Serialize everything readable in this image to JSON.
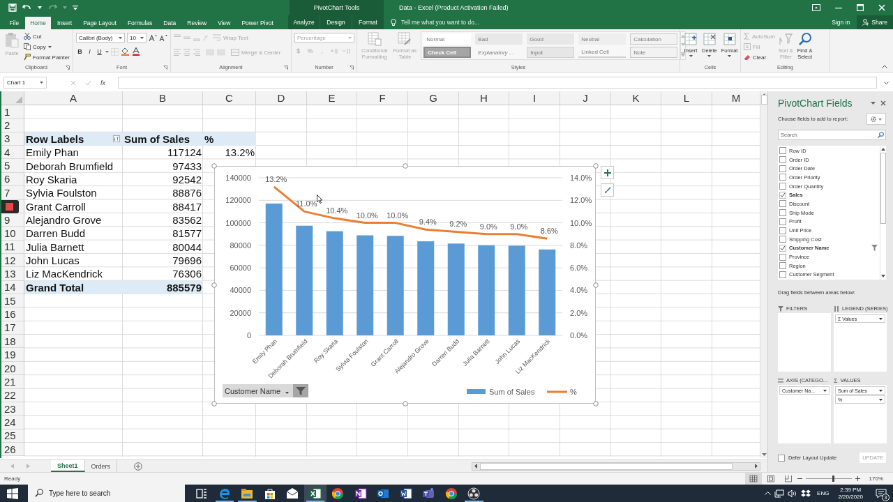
{
  "title_bar": {
    "contextual_label": "PivotChart Tools",
    "title": "Data - Excel (Product Activation Failed)"
  },
  "tabs": [
    {
      "label": "File",
      "selected": false,
      "contextual": false
    },
    {
      "label": "Home",
      "selected": true,
      "contextual": false
    },
    {
      "label": "Insert",
      "selected": false,
      "contextual": false
    },
    {
      "label": "Page Layout",
      "selected": false,
      "contextual": false
    },
    {
      "label": "Formulas",
      "selected": false,
      "contextual": false
    },
    {
      "label": "Data",
      "selected": false,
      "contextual": false
    },
    {
      "label": "Review",
      "selected": false,
      "contextual": false
    },
    {
      "label": "View",
      "selected": false,
      "contextual": false
    },
    {
      "label": "Power Pivot",
      "selected": false,
      "contextual": false
    },
    {
      "label": "Analyze",
      "selected": false,
      "contextual": true
    },
    {
      "label": "Design",
      "selected": false,
      "contextual": true
    },
    {
      "label": "Format",
      "selected": false,
      "contextual": true
    }
  ],
  "tell_me": {
    "placeholder": "Tell me what you want to do..."
  },
  "account": {
    "sign_in": "Sign in",
    "share": "Share"
  },
  "ribbon": {
    "clipboard": {
      "label": "Clipboard",
      "paste": {
        "label": "Paste",
        "disabled": true
      },
      "cut": {
        "label": "Cut",
        "disabled": false
      },
      "copy": {
        "label": "Copy",
        "disabled": false
      },
      "format_painter": {
        "label": "Format Painter",
        "disabled": false
      }
    },
    "font": {
      "label": "Font",
      "font_name": "Calibri (Body)",
      "font_size": "10",
      "bold": "B",
      "italic": "I",
      "underline": "U"
    },
    "alignment": {
      "label": "Alignment",
      "wrap_text": {
        "label": "Wrap Text",
        "disabled": true
      },
      "merge_center": {
        "label": "Merge & Center",
        "disabled": true
      }
    },
    "number": {
      "label": "Number",
      "format": "Percentage",
      "currency": "$",
      "percent": "%",
      "comma": ","
    },
    "styles": {
      "label": "Styles",
      "conditional_formatting": {
        "lines": [
          "Conditional",
          "Formatting"
        ],
        "disabled": true
      },
      "format_as_table": {
        "lines": [
          "Format as",
          "Table"
        ],
        "disabled": true
      },
      "cell_styles": [
        {
          "label": "Normal",
          "kind": "normal"
        },
        {
          "label": "Bad",
          "kind": "bad"
        },
        {
          "label": "Good",
          "kind": "good"
        },
        {
          "label": "Neutral",
          "kind": "neutral"
        },
        {
          "label": "Calculation",
          "kind": "calculation"
        },
        {
          "label": "Check Cell",
          "kind": "check"
        },
        {
          "label": "Explanatory ...",
          "kind": "explanatory"
        },
        {
          "label": "Input",
          "kind": "input"
        },
        {
          "label": "Linked Cell",
          "kind": "linked"
        },
        {
          "label": "Note",
          "kind": "note"
        }
      ]
    },
    "cells": {
      "label": "Cells",
      "buttons": [
        {
          "label": "Insert",
          "disabled": false
        },
        {
          "label": "Delete",
          "disabled": false
        },
        {
          "label": "Format",
          "disabled": false
        }
      ]
    },
    "editing": {
      "label": "Editing",
      "autosum": {
        "label": "AutoSum",
        "disabled": true
      },
      "fill": {
        "label": "Fill",
        "disabled": true
      },
      "clear": {
        "label": "Clear",
        "disabled": false
      },
      "sort_filter": {
        "lines": [
          "Sort &",
          "Filter"
        ],
        "disabled": true
      },
      "find_select": {
        "lines": [
          "Find &",
          "Select"
        ],
        "disabled": false
      }
    }
  },
  "formula_bar": {
    "name_box": "Chart 1",
    "fx": "fx"
  },
  "sheet": {
    "columns": [
      "A",
      "B",
      "C",
      "D",
      "E",
      "F",
      "G",
      "H",
      "I",
      "J",
      "K",
      "L",
      "M"
    ],
    "row_numbers": [
      {
        "label": "1"
      },
      {
        "label": "2"
      },
      {
        "label": "3"
      },
      {
        "label": "4"
      },
      {
        "label": "5"
      },
      {
        "label": "6"
      },
      {
        "label": "7"
      },
      {
        "covered": true
      },
      {
        "label": "9"
      },
      {
        "label": "10"
      },
      {
        "label": "11"
      },
      {
        "label": "12"
      },
      {
        "label": "13"
      },
      {
        "label": "14"
      },
      {
        "label": "15"
      },
      {
        "label": "16"
      },
      {
        "label": "17"
      },
      {
        "label": "18"
      },
      {
        "label": "19"
      },
      {
        "label": "20"
      },
      {
        "label": "21"
      },
      {
        "label": "22"
      },
      {
        "label": "23"
      },
      {
        "label": "24"
      },
      {
        "label": "25"
      },
      {
        "label": "26"
      }
    ],
    "pivot": {
      "header": {
        "row_labels": "Row Labels",
        "sum": "Sum of Sales",
        "pct": "%"
      },
      "rows": [
        {
          "name": "Emily Phan",
          "sales": "117124",
          "pct": "13.2%"
        },
        {
          "name": "Deborah Brumfield",
          "sales": "97433"
        },
        {
          "name": "Roy Skaria",
          "sales": "92542"
        },
        {
          "name": "Sylvia Foulston",
          "sales": "88876"
        },
        {
          "name": "Grant Carroll",
          "sales": "88417"
        },
        {
          "name": "Alejandro Grove",
          "sales": "83562"
        },
        {
          "name": "Darren Budd",
          "sales": "81577"
        },
        {
          "name": "Julia Barnett",
          "sales": "80044"
        },
        {
          "name": "John Lucas",
          "sales": "79696"
        },
        {
          "name": "Liz MacKendrick",
          "sales": "76306"
        }
      ],
      "total": {
        "label": "Grand Total",
        "sales": "885579"
      }
    },
    "tabs": [
      {
        "label": "Sheet1",
        "selected": true
      },
      {
        "label": "Orders",
        "selected": false
      }
    ]
  },
  "chart": {
    "field_button": "Customer Name",
    "chart_data": {
      "type": "bar",
      "categories": [
        "Emily Phan",
        "Deborah Brumfield",
        "Roy Skaria",
        "Sylvia Foulston",
        "Grant Carroll",
        "Alejandro Grove",
        "Darren Budd",
        "Julia Barnett",
        "John Lucas",
        "Liz MacKendrick"
      ],
      "series": [
        {
          "name": "Sum of Sales",
          "type": "bar",
          "color": "#5b9bd5",
          "values": [
            117124,
            97433,
            92542,
            88876,
            88417,
            83562,
            81577,
            80044,
            79696,
            76306
          ]
        },
        {
          "name": "%",
          "type": "line",
          "axis": "y2",
          "color": "#ed7d31",
          "values": [
            13.2,
            11.0,
            10.4,
            10.0,
            10.0,
            9.4,
            9.2,
            9.0,
            9.0,
            8.6
          ],
          "value_labels": [
            "13.2%",
            "11.0%",
            "10.4%",
            "10.0%",
            "10.0%",
            "9.4%",
            "9.2%",
            "9.0%",
            "9.0%",
            "8.6%"
          ]
        }
      ],
      "grid": true,
      "legend": "bottom",
      "ylim": [
        0,
        140000
      ],
      "yticks": [
        0,
        20000,
        40000,
        60000,
        80000,
        100000,
        120000,
        140000
      ],
      "y2lim": [
        0,
        14
      ],
      "y2ticks": [
        {
          "value": 0,
          "label": "0.0%"
        },
        {
          "value": 2,
          "label": "2.0%"
        },
        {
          "value": 4,
          "label": "4.0%"
        },
        {
          "value": 6,
          "label": "6.0%"
        },
        {
          "value": 8,
          "label": "8.0%"
        },
        {
          "value": 10,
          "label": "10.0%"
        },
        {
          "value": 12,
          "label": "12.0%"
        },
        {
          "value": 14,
          "label": "14.0%"
        }
      ]
    }
  },
  "field_pane": {
    "title": "PivotChart Fields",
    "prompt": "Choose fields to add to report:",
    "search": {
      "placeholder": "Search"
    },
    "fields": [
      {
        "label": "Row ID",
        "checked": false,
        "filtered": false
      },
      {
        "label": "Order ID",
        "checked": false,
        "filtered": false
      },
      {
        "label": "Order Date",
        "checked": false,
        "filtered": false
      },
      {
        "label": "Order Priority",
        "checked": false,
        "filtered": false
      },
      {
        "label": "Order Quantity",
        "checked": false,
        "filtered": false
      },
      {
        "label": "Sales",
        "checked": true,
        "filtered": false
      },
      {
        "label": "Discount",
        "checked": false,
        "filtered": false
      },
      {
        "label": "Ship Mode",
        "checked": false,
        "filtered": false
      },
      {
        "label": "Profit",
        "checked": false,
        "filtered": false
      },
      {
        "label": "Unit Price",
        "checked": false,
        "filtered": false
      },
      {
        "label": "Shipping Cost",
        "checked": false,
        "filtered": false
      },
      {
        "label": "Customer Name",
        "checked": true,
        "filtered": true
      },
      {
        "label": "Province",
        "checked": false,
        "filtered": false
      },
      {
        "label": "Region",
        "checked": false,
        "filtered": false
      },
      {
        "label": "Customer Segment",
        "checked": false,
        "filtered": false
      }
    ],
    "drag_hint": "Drag fields between areas below:",
    "areas": [
      {
        "label": "FILTERS",
        "kind": "filters"
      },
      {
        "label": "LEGEND (SERIES)",
        "kind": "legend",
        "items": [
          "Σ  Values"
        ]
      },
      {
        "label": "AXIS (CATEGO...",
        "kind": "axis",
        "items": [
          "Customer Na..."
        ]
      },
      {
        "label": "VALUES",
        "kind": "values",
        "symbol": "Σ",
        "items": [
          "Sum of Sales",
          "%"
        ]
      }
    ],
    "defer": {
      "label": "Defer Layout Update",
      "checked": false
    },
    "update": {
      "label": "UPDATE",
      "disabled": true
    }
  },
  "status_bar": {
    "status": "Ready",
    "zoom": {
      "label": "170%",
      "level": 0.6
    }
  },
  "taskbar": {
    "search": {
      "placeholder": "Type here to search"
    },
    "apps": [
      {
        "running": false,
        "active": false
      },
      {
        "running": true,
        "active": false
      },
      {
        "running": true,
        "active": false
      },
      {
        "running": false,
        "active": false
      },
      {
        "running": false,
        "active": false
      },
      {
        "running": true,
        "active": true
      },
      {
        "running": false,
        "active": false
      },
      {
        "running": false,
        "active": false
      },
      {
        "running": false,
        "active": false
      },
      {
        "running": false,
        "active": false
      },
      {
        "running": false,
        "active": false
      },
      {
        "running": false,
        "active": false
      },
      {
        "running": true,
        "active": false
      }
    ],
    "language": "ENG",
    "time": "2:39 PM",
    "date": "2/20/2020",
    "notifications": "3"
  }
}
